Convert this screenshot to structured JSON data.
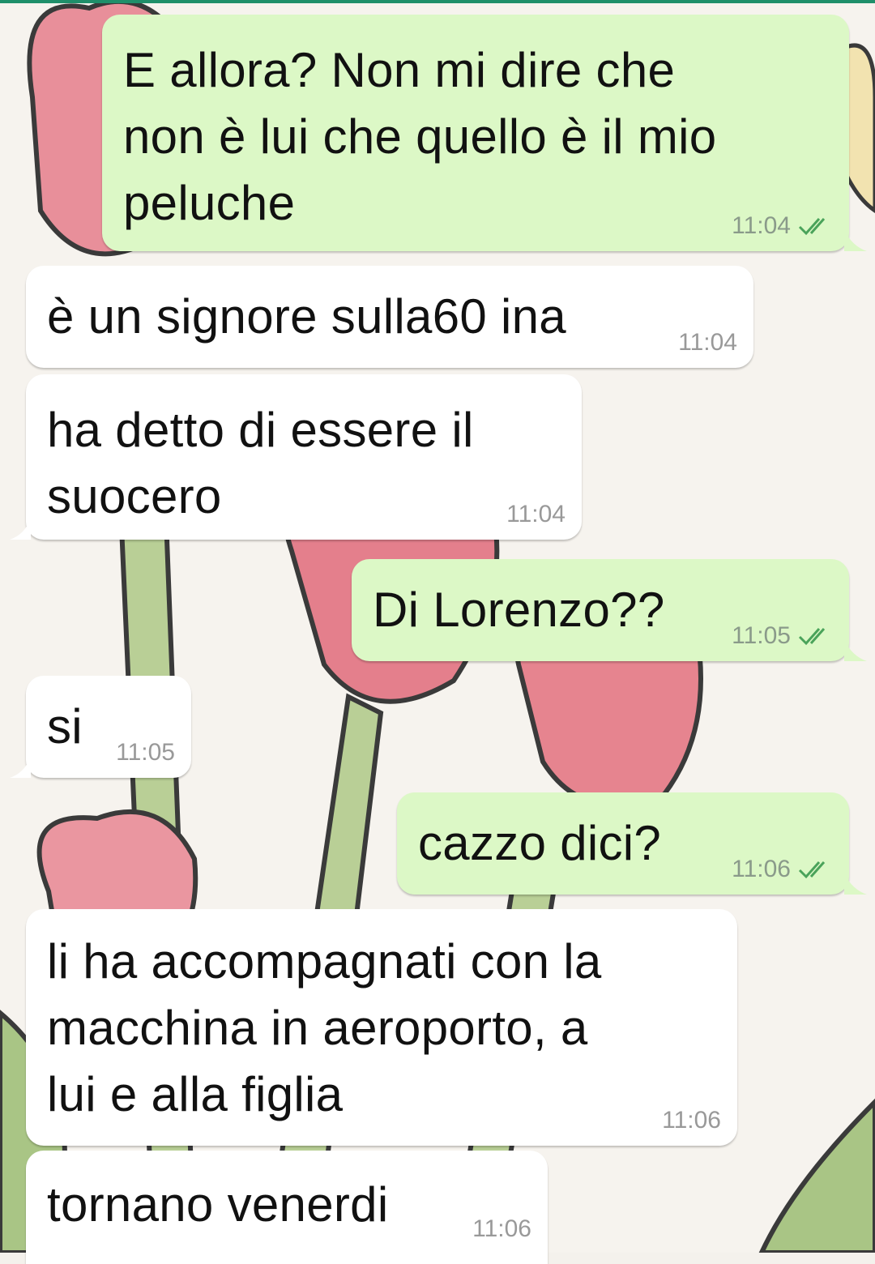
{
  "messages": [
    {
      "dir": "out",
      "text": "E allora? Non mi dire che\nnon è lui che quello è il mio\npeluche",
      "time": "11:04"
    },
    {
      "dir": "in",
      "text": "è un signore sulla60 ina",
      "time": "11:04"
    },
    {
      "dir": "in",
      "text": "ha detto di essere il\nsuocero",
      "time": "11:04"
    },
    {
      "dir": "out",
      "text": "Di Lorenzo??",
      "time": "11:05"
    },
    {
      "dir": "in",
      "text": "si",
      "time": "11:05"
    },
    {
      "dir": "out",
      "text": "cazzo dici?",
      "time": "11:06"
    },
    {
      "dir": "in",
      "text": "li ha accompagnati con la\nmacchina in aeroporto, a\nlui e alla figlia",
      "time": "11:06"
    },
    {
      "dir": "in",
      "text": "tornano venerdi",
      "time": "11:06"
    }
  ],
  "colors": {
    "outgoing_bubble": "#dcf8c6",
    "incoming_bubble": "#ffffff",
    "read_tick": "#4fc3f7",
    "sent_tick": "#4aa35a"
  },
  "icons": {
    "tick": "double-check-icon"
  }
}
